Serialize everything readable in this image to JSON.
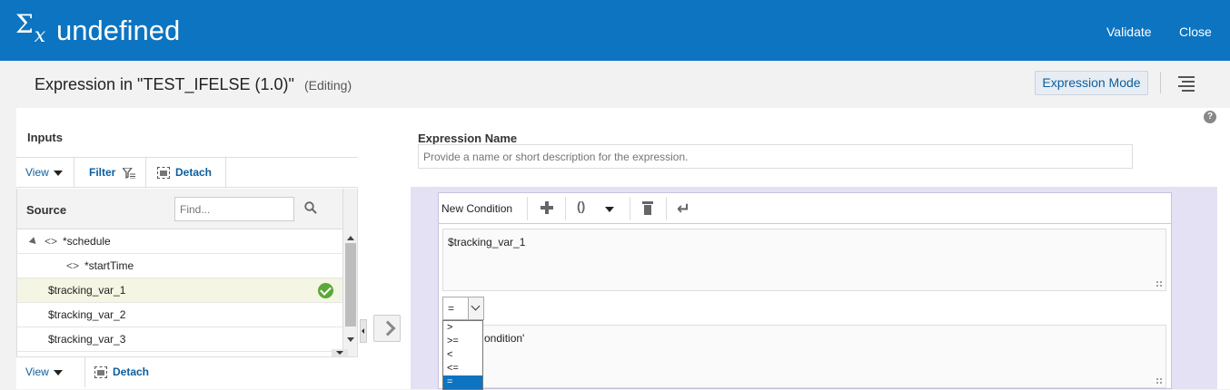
{
  "header": {
    "sigma_symbol": "Σ",
    "sigma_sub": "x",
    "title": "undefined",
    "validate": "Validate",
    "close": "Close"
  },
  "subheader": {
    "expression_title": "Expression in \"TEST_IFELSE (1.0)\"",
    "status": "(Editing)",
    "mode_button": "Expression Mode"
  },
  "inputs": {
    "title": "Inputs",
    "toolbar": {
      "view": "View",
      "filter": "Filter",
      "detach": "Detach"
    },
    "source_label": "Source",
    "find_placeholder": "Find...",
    "rows": [
      {
        "label": "*schedule",
        "icon": "code-brackets-icon",
        "expanded": true
      },
      {
        "label": "*startTime",
        "icon": "code-brackets-icon"
      },
      {
        "label": "$tracking_var_1",
        "selected": true,
        "valid": true
      },
      {
        "label": "$tracking_var_2"
      },
      {
        "label": "$tracking_var_3"
      }
    ],
    "bottom_toolbar": {
      "view": "View",
      "detach": "Detach"
    }
  },
  "expression": {
    "name_label": "Expression Name",
    "name_placeholder": "Provide a name or short description for the expression.",
    "condition_toolbar": {
      "new_condition": "New Condition",
      "paren": "()"
    },
    "left_operand": "$tracking_var_1",
    "operator_value": "=",
    "operator_options": [
      ">",
      ">=",
      "<",
      "<=",
      "="
    ],
    "right_operand": "'condition'",
    "right_operand_visible": "ondition'"
  },
  "colors": {
    "header_bg": "#0c74c1",
    "condition_bg": "#e4e1f5",
    "valid_check": "#5aa83a"
  }
}
